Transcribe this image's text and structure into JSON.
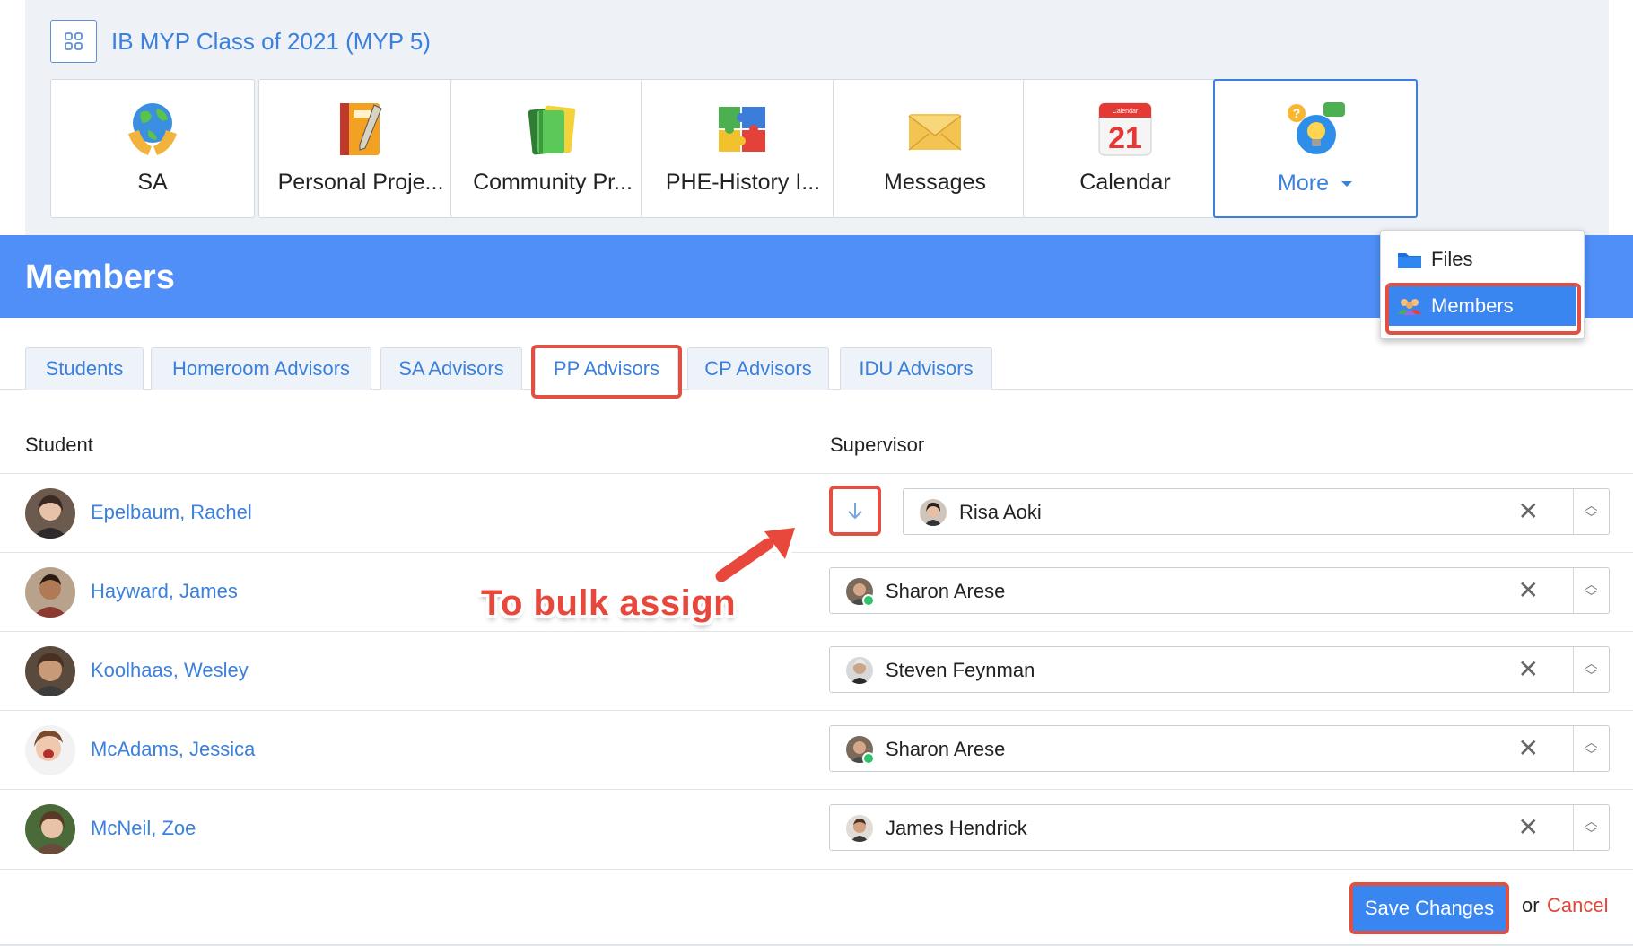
{
  "class_title": "IB MYP Class of 2021 (MYP 5)",
  "apps": [
    {
      "label": "SA",
      "icon": "globe-hands-icon"
    },
    {
      "label": "Personal Proje...",
      "icon": "notebook-icon"
    },
    {
      "label": "Community Pr...",
      "icon": "books-icon"
    },
    {
      "label": "PHE-History I...",
      "icon": "puzzle-icon"
    },
    {
      "label": "Messages",
      "icon": "envelope-icon"
    },
    {
      "label": "Calendar",
      "icon": "calendar-icon",
      "calendar_header": "Calendar",
      "calendar_day": "21"
    },
    {
      "label": "More",
      "icon": "lightbulb-chat-icon"
    }
  ],
  "more_menu": {
    "items": [
      {
        "label": "Files",
        "icon": "folder-icon"
      },
      {
        "label": "Members",
        "icon": "people-icon",
        "selected": true
      }
    ]
  },
  "page_title": "Members",
  "tabs": [
    {
      "label": "Students"
    },
    {
      "label": "Homeroom Advisors"
    },
    {
      "label": "SA Advisors"
    },
    {
      "label": "PP Advisors",
      "active": true
    },
    {
      "label": "CP Advisors"
    },
    {
      "label": "IDU Advisors"
    }
  ],
  "table": {
    "headers": {
      "student": "Student",
      "supervisor": "Supervisor"
    },
    "rows": [
      {
        "student": "Epelbaum, Rachel",
        "supervisor": "Risa Aoki",
        "online": false
      },
      {
        "student": "Hayward, James",
        "supervisor": "Sharon Arese",
        "online": true
      },
      {
        "student": "Koolhaas, Wesley",
        "supervisor": "Steven Feynman",
        "online": false
      },
      {
        "student": "McAdams, Jessica",
        "supervisor": "Sharon Arese",
        "online": true
      },
      {
        "student": "McNeil, Zoe",
        "supervisor": "James Hendrick",
        "online": false
      }
    ]
  },
  "annotation": "To bulk assign",
  "footer": {
    "save_label": "Save Changes",
    "or_text": "or",
    "cancel_label": "Cancel"
  },
  "colors": {
    "accent": "#3a80dc",
    "header_blue": "#4f8ff7",
    "highlight_red": "#e05144",
    "cancel_red": "#e0453a",
    "online_green": "#2ec26a"
  }
}
